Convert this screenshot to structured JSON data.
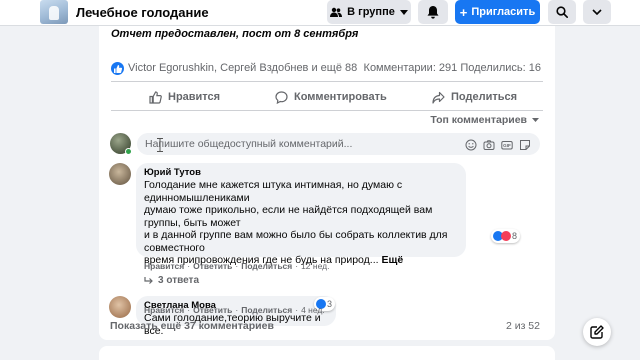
{
  "header": {
    "group_title": "Лечебное голодание",
    "member_label": "В группе",
    "invite_label": "Пригласить"
  },
  "post": {
    "report_text": "Отчет предоставлен, пост от 8 сентября",
    "likers": "Victor Egorushkin, Сергей Вздобнев и ещё 88",
    "counts": "Комментарии: 291  Поделились: 16"
  },
  "actions": {
    "like": "Нравится",
    "comment": "Комментировать",
    "share": "Поделиться"
  },
  "sort_label": "Топ комментариев",
  "comment_box": {
    "placeholder": "Напишите общедоступный комментарий..."
  },
  "comments": [
    {
      "author": "Юрий Тутов",
      "text_1": "Голодание мне кажется штука интимная, но думаю с единномышлениками",
      "text_2": "думаю тоже прикольно, если не найдётся подходящей вам группы, быть может",
      "text_3": "и в данной группе вам можно было бы собрать коллектив для совместного",
      "text_4": "время припровождения где не будь на природ...",
      "more": "Ещё",
      "like": "Нравится",
      "reply": "Ответить",
      "share": "Поделиться",
      "time": "12 нед.",
      "reactions": "8",
      "replies": "3 ответа"
    },
    {
      "author": "Светлана Мова",
      "text_1": "Сами голодание,теорию выручите и все.",
      "like": "Нравится",
      "reply": "Ответить",
      "share": "Поделиться",
      "time": "4 нед.",
      "reactions": "3"
    }
  ],
  "footer": {
    "show_more": "Показать ещё 37 комментариев",
    "pagination": "2 из 52"
  },
  "colors": {
    "accent": "#1877f2",
    "background": "#f0f2f5",
    "secondary_text": "#65676b",
    "heart": "#f33e58"
  }
}
